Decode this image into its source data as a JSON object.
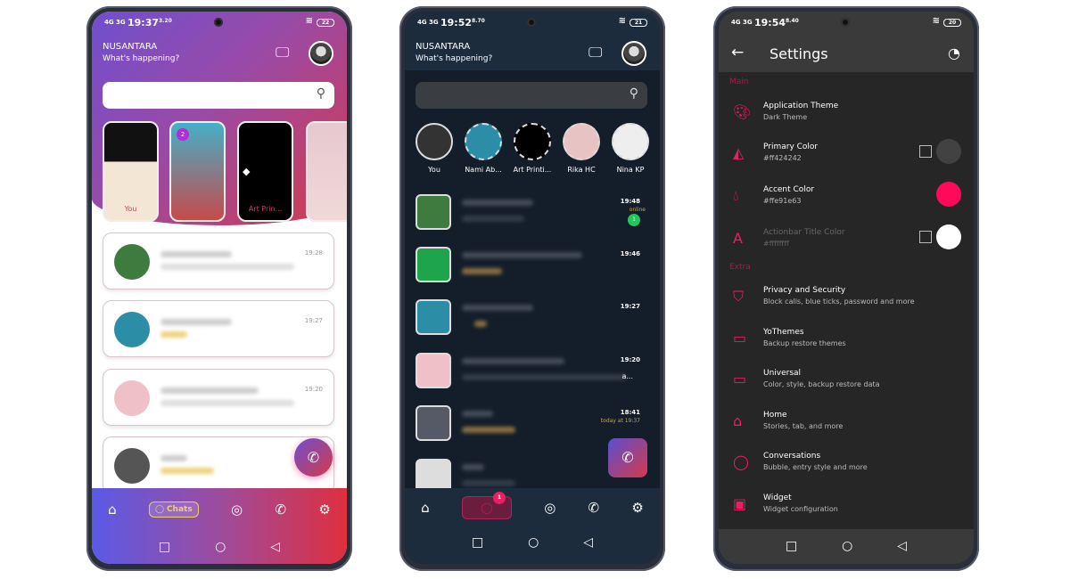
{
  "phones": [
    {
      "status": {
        "signal": "4G 3G",
        "time": "19:37",
        "speed": "3.20",
        "battery": "22"
      },
      "header": {
        "title": "NUSANTARA",
        "subtitle": "What's happening?"
      },
      "stories": [
        {
          "label": "You"
        },
        {
          "label": "",
          "badge": "2"
        },
        {
          "label": "Art Prin..."
        },
        {
          "label": ""
        }
      ],
      "chats": [
        {
          "time": "19:28"
        },
        {
          "time": "19:27"
        },
        {
          "time": "19:20"
        },
        {
          "time": ""
        }
      ],
      "nav": {
        "active_label": "Chats",
        "items": [
          "home-icon",
          "chats-icon",
          "status-icon",
          "calls-icon",
          "settings-icon"
        ]
      },
      "colors": {
        "gradient_start": "#6f4fcf",
        "gradient_end": "#d53a4a"
      }
    },
    {
      "status": {
        "signal": "4G 3G",
        "time": "19:52",
        "speed": "8.70",
        "battery": "21"
      },
      "header": {
        "title": "NUSANTARA",
        "subtitle": "What's happening?"
      },
      "stories": [
        {
          "label": "You"
        },
        {
          "label": "Nami Ab..."
        },
        {
          "label": "Art Printi..."
        },
        {
          "label": "Rika HC"
        },
        {
          "label": "Nina KP"
        }
      ],
      "chats": [
        {
          "time": "19:48",
          "status": "online",
          "unread": "1"
        },
        {
          "time": "19:46"
        },
        {
          "time": "19:27"
        },
        {
          "time": "19:20",
          "preview_tail": "a..."
        },
        {
          "time": "18:41",
          "status": "today at 19:37"
        },
        {
          "time": ""
        }
      ],
      "nav": {
        "badge": "1"
      },
      "colors": {
        "background": "#141e2a",
        "header": "#1c2c3d",
        "online": "#22c55e"
      }
    },
    {
      "status": {
        "signal": "4G 3G",
        "time": "19:54",
        "speed": "8.40",
        "battery": "20"
      },
      "toolbar": {
        "title": "Settings"
      },
      "sections": [
        {
          "title": "Main",
          "items": [
            {
              "title": "Application Theme",
              "subtitle": "Dark Theme",
              "icon": "palette-icon"
            },
            {
              "title": "Primary Color",
              "subtitle": "#ff424242",
              "icon": "paint-bucket-icon",
              "swatch": "#424242",
              "checkbox": false
            },
            {
              "title": "Accent Color",
              "subtitle": "#ffe91e63",
              "icon": "drop-icon",
              "swatch": "#e91e63"
            },
            {
              "title": "Actionbar Title Color",
              "subtitle": "#ffffffff",
              "icon": "text-color-icon",
              "swatch": "#ffffff",
              "checkbox": false,
              "disabled": true
            }
          ]
        },
        {
          "title": "Extra",
          "items": [
            {
              "title": "Privacy and Security",
              "subtitle": "Block calls, blue ticks, password and more",
              "icon": "shield-icon"
            },
            {
              "title": "YoThemes",
              "subtitle": "Backup restore themes",
              "icon": "themes-icon"
            },
            {
              "title": "Universal",
              "subtitle": "Color, style, backup restore data",
              "icon": "universal-icon"
            },
            {
              "title": "Home",
              "subtitle": "Stories, tab, and more",
              "icon": "home-icon"
            },
            {
              "title": "Conversations",
              "subtitle": "Bubble, entry style and more",
              "icon": "chat-bubble-icon"
            },
            {
              "title": "Widget",
              "subtitle": "Widget configuration",
              "icon": "widget-icon"
            }
          ]
        }
      ],
      "colors": {
        "accent": "#e91e63",
        "background": "#262626",
        "toolbar": "#3a3a3a"
      }
    }
  ]
}
